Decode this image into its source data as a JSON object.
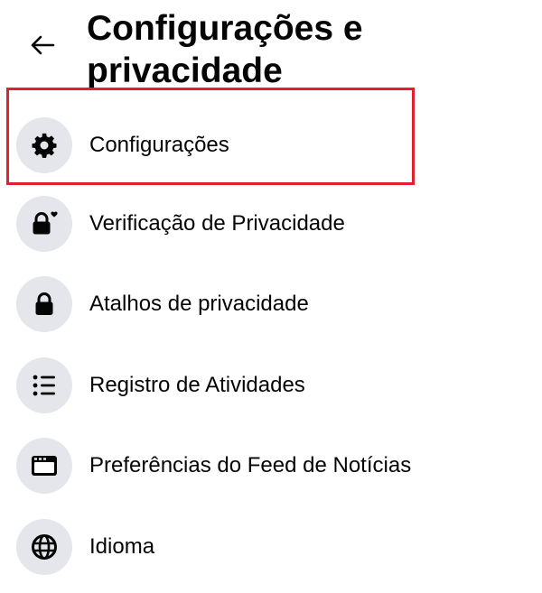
{
  "header": {
    "back_icon": "arrow-left-icon",
    "title": "Configurações e privacidade"
  },
  "menu": {
    "items": [
      {
        "label": "Configurações",
        "icon": "gear-icon",
        "highlighted": true
      },
      {
        "label": "Verificação de Privacidade",
        "icon": "lock-heart-icon"
      },
      {
        "label": "Atalhos de privacidade",
        "icon": "lock-icon"
      },
      {
        "label": "Registro de Atividades",
        "icon": "list-icon"
      },
      {
        "label": "Preferências do Feed de Notícias",
        "icon": "feed-icon"
      },
      {
        "label": "Idioma",
        "icon": "globe-icon"
      }
    ]
  },
  "colors": {
    "highlight_border": "#e0202e",
    "icon_background": "#e4e6eb",
    "text": "#050505"
  }
}
